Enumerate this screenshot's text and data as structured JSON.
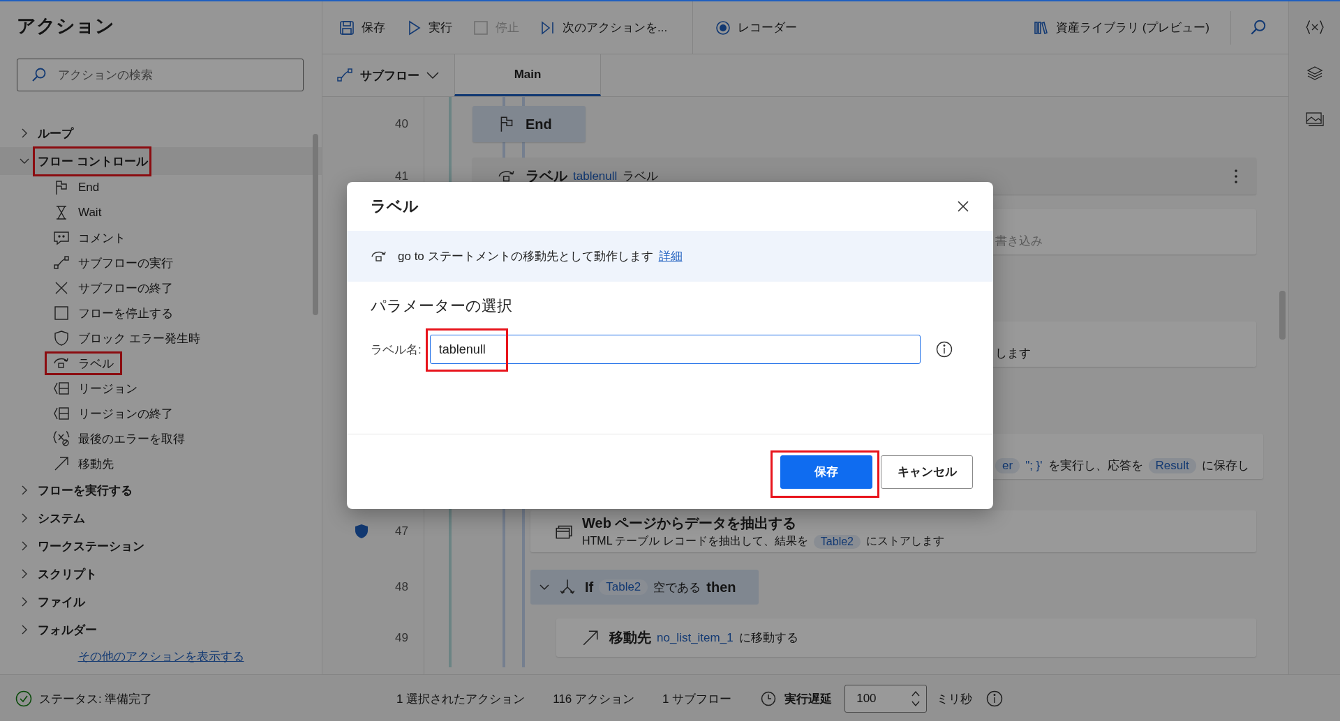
{
  "actions_panel": {
    "title": "アクション",
    "search": {
      "placeholder": "アクションの検索"
    },
    "tree": [
      {
        "label": "ループ",
        "expanded": false,
        "highlighted": false
      },
      {
        "label": "フロー コントロール",
        "expanded": true,
        "highlighted": true,
        "children": [
          {
            "label": "End",
            "highlighted": false
          },
          {
            "label": "Wait",
            "highlighted": false
          },
          {
            "label": "コメント",
            "highlighted": false
          },
          {
            "label": "サブフローの実行",
            "highlighted": false
          },
          {
            "label": "サブフローの終了",
            "highlighted": false
          },
          {
            "label": "フローを停止する",
            "highlighted": false
          },
          {
            "label": "ブロック エラー発生時",
            "highlighted": false
          },
          {
            "label": "ラベル",
            "highlighted": true
          },
          {
            "label": "リージョン",
            "highlighted": false
          },
          {
            "label": "リージョンの終了",
            "highlighted": false
          },
          {
            "label": "最後のエラーを取得",
            "highlighted": false
          },
          {
            "label": "移動先",
            "highlighted": false
          }
        ]
      },
      {
        "label": "フローを実行する",
        "expanded": false,
        "highlighted": false
      },
      {
        "label": "システム",
        "expanded": false,
        "highlighted": false
      },
      {
        "label": "ワークステーション",
        "expanded": false,
        "highlighted": false
      },
      {
        "label": "スクリプト",
        "expanded": false,
        "highlighted": false
      },
      {
        "label": "ファイル",
        "expanded": false,
        "highlighted": false
      },
      {
        "label": "フォルダー",
        "expanded": false,
        "highlighted": false
      }
    ],
    "more_link": "その他のアクションを表示する"
  },
  "toolbar": {
    "buttons": [
      {
        "label": "保存",
        "disabled": false
      },
      {
        "label": "実行",
        "disabled": false
      },
      {
        "label": "停止",
        "disabled": true
      },
      {
        "label": "次のアクションを...",
        "disabled": false
      }
    ],
    "recorder": "レコーダー",
    "library": "資産ライブラリ (プレビュー)"
  },
  "subflow_bar": {
    "label": "サブフロー",
    "tabs": [
      {
        "label": "Main",
        "selected": true
      }
    ]
  },
  "flow": {
    "rows": [
      {
        "kind": "end",
        "number": "40",
        "shield": false,
        "parts": [
          {
            "kind": "bold",
            "text": "End"
          }
        ]
      },
      {
        "kind": "label",
        "number": "41",
        "shield": false,
        "parts": [
          {
            "kind": "bold",
            "text": "ラベル"
          },
          {
            "kind": "link",
            "text": "tablenull"
          },
          {
            "kind": "text",
            "text": "ラベル"
          }
        ]
      },
      {
        "kind": "partial",
        "parts": [
          {
            "kind": "muted",
            "text": "書き込み"
          }
        ]
      },
      {
        "kind": "partial",
        "parts": [
          {
            "kind": "text",
            "text": "します"
          }
        ]
      },
      {
        "kind": "partial",
        "parts": [
          {
            "kind": "pill",
            "text": "er"
          },
          {
            "kind": "link",
            "text": "\"; }'"
          },
          {
            "kind": "text",
            "text": "を実行し、応答を"
          },
          {
            "kind": "pill",
            "text": "Result"
          },
          {
            "kind": "text",
            "text": "に保存し"
          }
        ]
      },
      {
        "kind": "action",
        "number": "47",
        "shield": true,
        "title": "Web ページからデータを抽出する",
        "parts": [
          {
            "kind": "text",
            "text": "HTML テーブル レコードを抽出して、結果を"
          },
          {
            "kind": "pill",
            "text": "Table2"
          },
          {
            "kind": "text",
            "text": "にストアします"
          }
        ]
      },
      {
        "kind": "if",
        "number": "48",
        "shield": false,
        "expanded": true,
        "parts": [
          {
            "kind": "bold",
            "text": "If"
          },
          {
            "kind": "pill",
            "text": "Table2"
          },
          {
            "kind": "text",
            "text": "空である"
          },
          {
            "kind": "bold",
            "text": "then"
          }
        ]
      },
      {
        "kind": "goto",
        "number": "49",
        "shield": false,
        "parts": [
          {
            "kind": "bold",
            "text": "移動先"
          },
          {
            "kind": "link",
            "text": "no_list_item_1"
          },
          {
            "kind": "text",
            "text": "に移動する"
          }
        ]
      }
    ]
  },
  "dialog": {
    "title": "ラベル",
    "info": "go to ステートメントの移動先として動作します",
    "info_link": "詳細",
    "section": "パラメーターの選択",
    "field_label": "ラベル名:",
    "field_value": "tablenull",
    "field_highlighted": true,
    "buttons": [
      {
        "label": "保存",
        "primary": true,
        "highlighted": true
      },
      {
        "label": "キャンセル",
        "primary": false,
        "highlighted": false
      }
    ]
  },
  "status_bar": {
    "status": "ステータス: 準備完了",
    "selected": "1 選択されたアクション",
    "actions": "116 アクション",
    "subflows": "1 サブフロー",
    "delay_label": "実行遅延",
    "delay_value": "100",
    "delay_unit": "ミリ秒"
  }
}
